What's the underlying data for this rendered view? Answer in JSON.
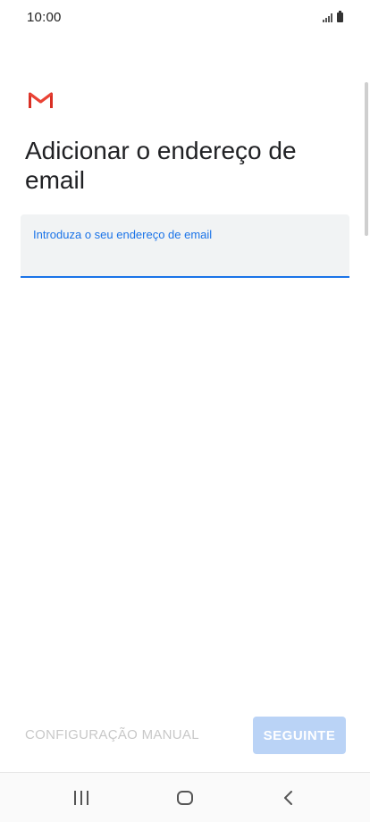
{
  "status_bar": {
    "time": "10:00"
  },
  "header": {
    "logo_icon": "gmail-icon",
    "title": "Adicionar o endereço de email"
  },
  "form": {
    "email_label": "Introduza o seu endereço de email",
    "email_value": "",
    "email_placeholder": ""
  },
  "actions": {
    "manual_label": "CONFIGURAÇÃO MANUAL",
    "next_label": "SEGUINTE"
  },
  "nav_bar": {
    "recent_icon": "recent-apps-icon",
    "home_icon": "home-icon",
    "back_icon": "back-icon"
  },
  "colors": {
    "accent": "#1a73e8",
    "field_background": "#f1f3f4",
    "next_button_disabled": "#bad3f6",
    "gmail_red": "#d93025"
  }
}
